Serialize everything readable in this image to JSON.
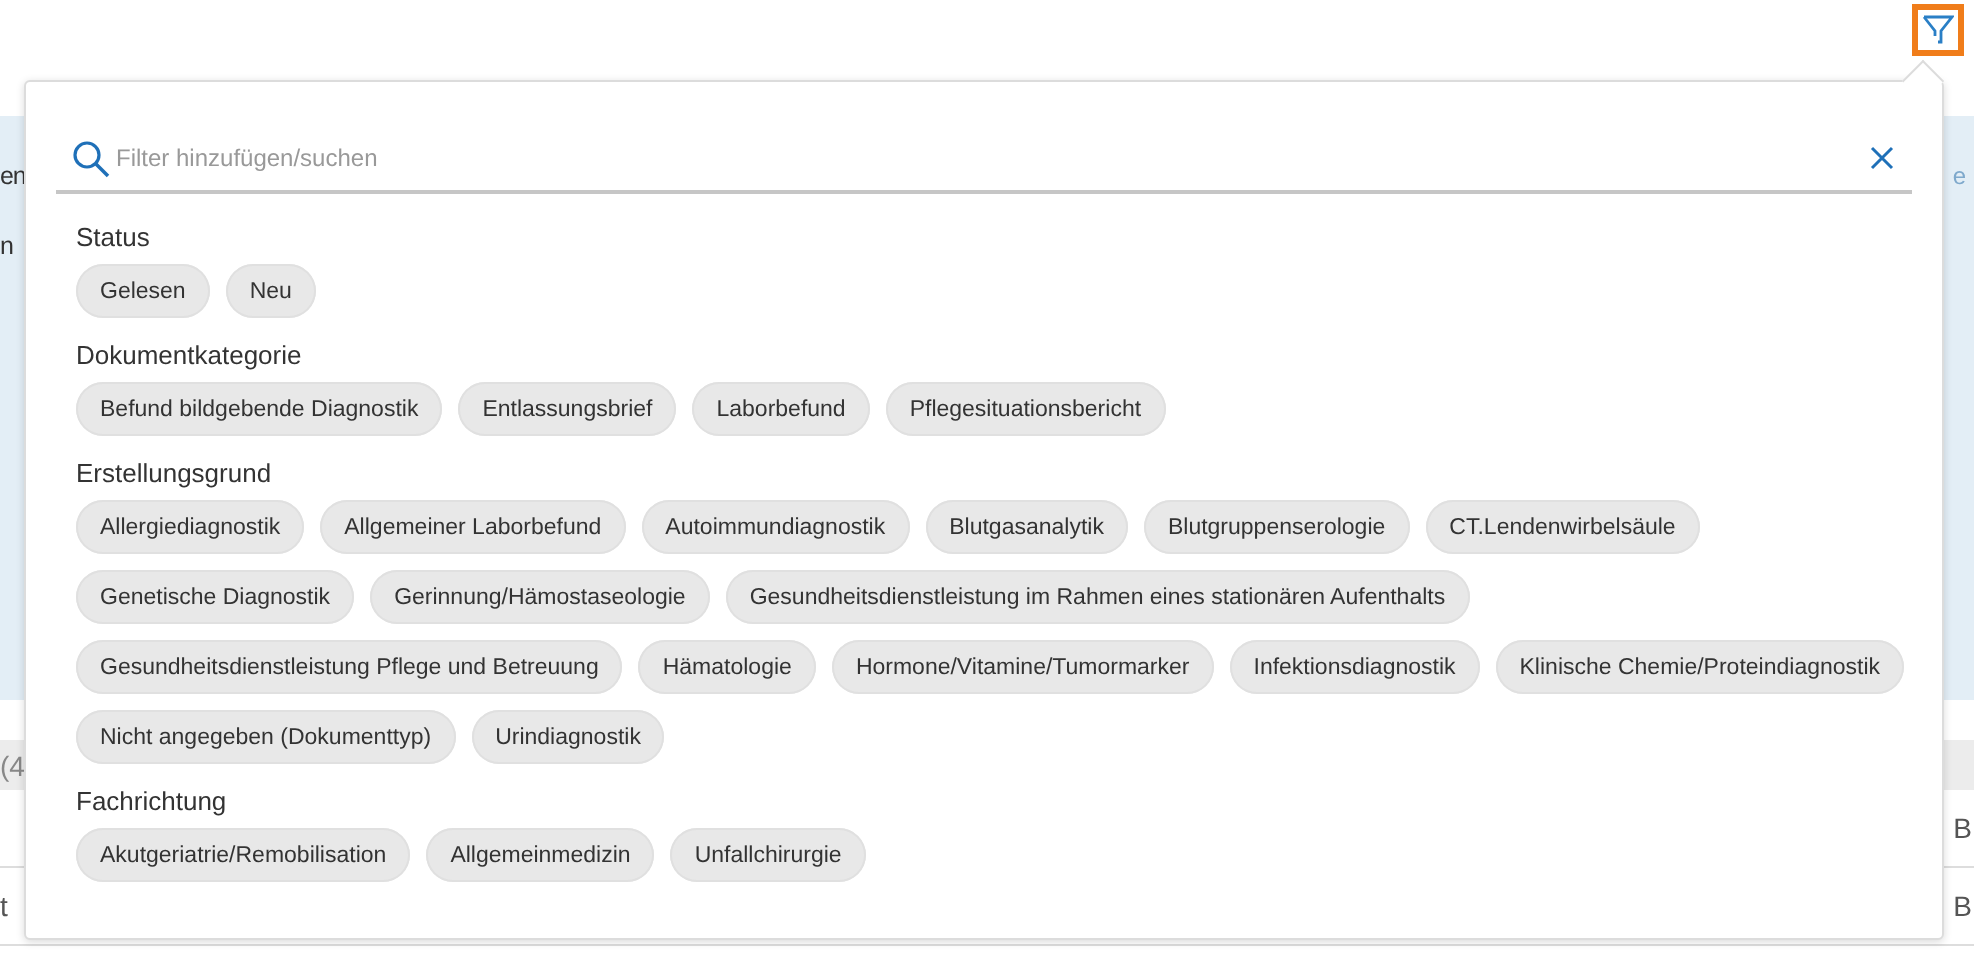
{
  "filter_button": {
    "active": true
  },
  "banner": {
    "left_texts": [
      "en",
      "n"
    ],
    "right_text": "e"
  },
  "list": {
    "header": "(4",
    "rows": [
      {
        "column_2": "B"
      },
      {
        "column_1": "t",
        "column_2": "B"
      }
    ]
  },
  "filter_panel": {
    "search": {
      "placeholder": "Filter hinzufügen/suchen"
    },
    "sections": [
      {
        "title": "Status",
        "chips": [
          "Gelesen",
          "Neu"
        ]
      },
      {
        "title": "Dokumentkategorie",
        "chips": [
          "Befund bildgebende Diagnostik",
          "Entlassungsbrief",
          "Laborbefund",
          "Pflegesituationsbericht"
        ]
      },
      {
        "title": "Erstellungsgrund",
        "chips": [
          "Allergiediagnostik",
          "Allgemeiner Laborbefund",
          "Autoimmundiagnostik",
          "Blutgasanalytik",
          "Blutgruppenserologie",
          "CT.Lendenwirbelsäule",
          "Genetische Diagnostik",
          "Gerinnung/Hämostaseologie",
          "Gesundheitsdienstleistung im Rahmen eines stationären Aufenthalts",
          "Gesundheitsdienstleistung Pflege und Betreuung",
          "Hämatologie",
          "Hormone/Vitamine/Tumormarker",
          "Infektionsdiagnostik",
          "Klinische Chemie/Proteindiagnostik",
          "Nicht angegeben (Dokumenttyp)",
          "Urindiagnostik"
        ]
      },
      {
        "title": "Fachrichtung",
        "chips": [
          "Akutgeriatrie/Remobilisation",
          "Allgemeinmedizin",
          "Unfallchirurgie"
        ]
      }
    ]
  }
}
